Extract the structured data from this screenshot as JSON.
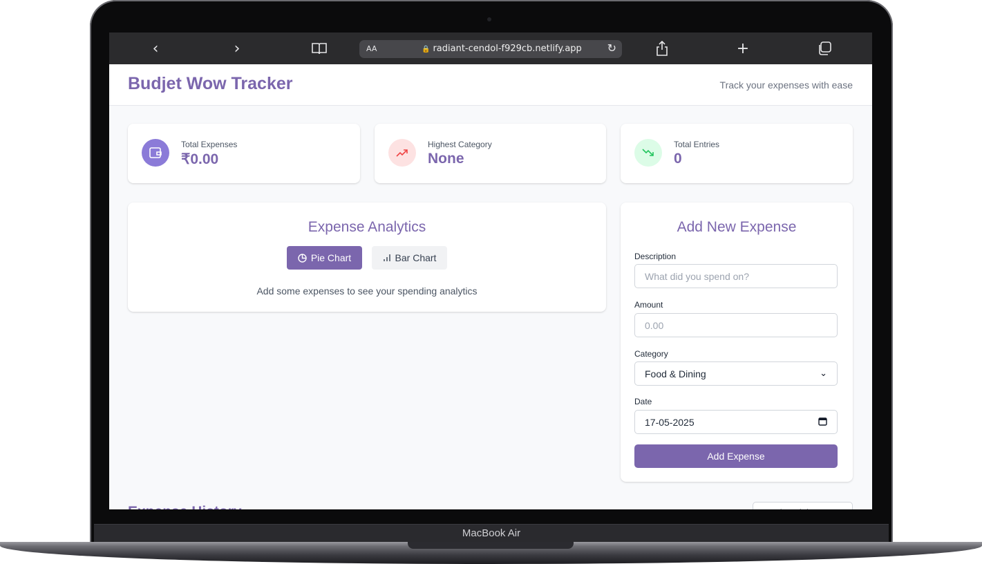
{
  "device": {
    "label": "MacBook Air"
  },
  "browser": {
    "reader_label": "AA",
    "url": "radiant-cendol-f929cb.netlify.app"
  },
  "app": {
    "title": "Budjet Wow Tracker",
    "subtitle": "Track your expenses with ease",
    "brand_color": "#7b66ad"
  },
  "stats": [
    {
      "label": "Total Expenses",
      "value": "₹0.00",
      "icon": "wallet-icon",
      "icon_bg": "#8b7bd8"
    },
    {
      "label": "Highest Category",
      "value": "None",
      "icon": "trending-up-icon",
      "icon_bg": "#fde2e2"
    },
    {
      "label": "Total Entries",
      "value": "0",
      "icon": "trending-down-icon",
      "icon_bg": "#dcfce7"
    }
  ],
  "analytics": {
    "title": "Expense Analytics",
    "tabs": [
      {
        "label": "Pie Chart",
        "icon": "pie-chart-icon",
        "active": true
      },
      {
        "label": "Bar Chart",
        "icon": "bar-chart-icon",
        "active": false
      }
    ],
    "empty_message": "Add some expenses to see your spending analytics"
  },
  "form": {
    "title": "Add New Expense",
    "description": {
      "label": "Description",
      "placeholder": "What did you spend on?"
    },
    "amount": {
      "label": "Amount",
      "placeholder": "0.00"
    },
    "category": {
      "label": "Category",
      "value": "Food & Dining"
    },
    "date": {
      "label": "Date",
      "value": "17-05-2025"
    },
    "submit_label": "Add Expense"
  },
  "history": {
    "title": "Expense History",
    "filter_value": "Food & Dining"
  }
}
